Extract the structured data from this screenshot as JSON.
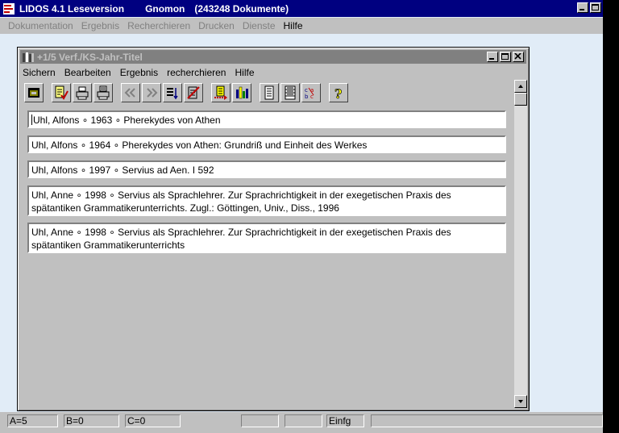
{
  "app": {
    "title": "LIDOS 4.1 Leseversion",
    "database": "Gnomon",
    "doc_count": "(243248 Dokumente)"
  },
  "app_menu": [
    {
      "label": "Dokumentation",
      "enabled": false
    },
    {
      "label": "Ergebnis",
      "enabled": false
    },
    {
      "label": "Recherchieren",
      "enabled": false
    },
    {
      "label": "Drucken",
      "enabled": false
    },
    {
      "label": "Dienste",
      "enabled": false
    },
    {
      "label": "Hilfe",
      "enabled": true
    }
  ],
  "child_window": {
    "title": "+1/5  Verf./KS-Jahr-Titel"
  },
  "child_menu": [
    "Sichern",
    "Bearbeiten",
    "Ergebnis",
    "recherchieren",
    "Hilfe"
  ],
  "toolbar": [
    "window-icon",
    "edit-check-icon",
    "print-icon",
    "print-list-icon",
    "first-record-icon",
    "last-record-icon",
    "sort-icon",
    "delete-icon",
    "export-icon",
    "statistics-icon",
    "document-icon",
    "list-icon",
    "abc-sort-icon",
    "help-icon"
  ],
  "records": [
    "Uhl, Alfons ∘ 1963 ∘ Pherekydes von Athen",
    "Uhl, Alfons ∘ 1964 ∘ Pherekydes von Athen: Grundriß und Einheit des Werkes",
    "Uhl, Alfons ∘ 1997 ∘ Servius ad Aen. I 592",
    "Uhl, Anne ∘ 1998 ∘ Servius als Sprachlehrer. Zur Sprachrichtigkeit in der exegetischen Praxis des spätantiken Grammatikerunterrichts. Zugl.: Göttingen, Univ., Diss., 1996",
    "Uhl, Anne ∘ 1998 ∘ Servius als Sprachlehrer. Zur Sprachrichtigkeit in der exegetischen Praxis des spätantiken Grammatikerunterrichts"
  ],
  "status": {
    "a": "A=5",
    "b": "B=0",
    "c": "C=0",
    "mode": "Einfg"
  },
  "colors": {
    "titlebar": "#000080",
    "inactive_titlebar": "#808080",
    "desktop": "#e1ecf7",
    "face": "#c0c0c0"
  }
}
